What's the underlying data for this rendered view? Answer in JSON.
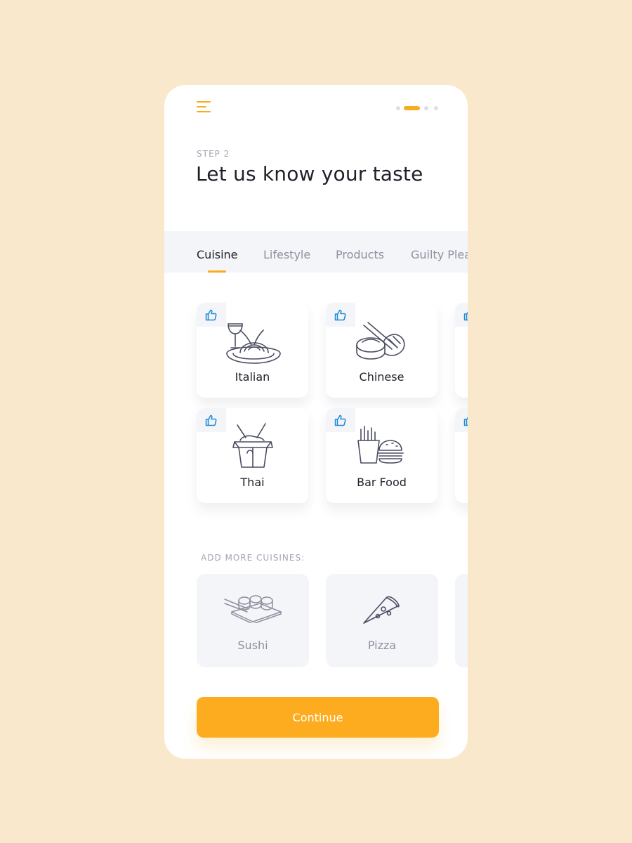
{
  "header": {
    "step_label": "STEP 2",
    "title": "Let us know your taste",
    "progress": {
      "total_steps": 4,
      "current_step": 2
    }
  },
  "tabs": [
    {
      "label": "Cuisine",
      "active": true
    },
    {
      "label": "Lifestyle",
      "active": false
    },
    {
      "label": "Products",
      "active": false
    },
    {
      "label": "Guilty Plea",
      "active": false
    }
  ],
  "cuisines": [
    {
      "label": "Italian",
      "icon": "pasta-icon",
      "liked": true
    },
    {
      "label": "Chinese",
      "icon": "dumpling-icon",
      "liked": true
    },
    {
      "label": "Thai",
      "icon": "noodle-box-icon",
      "liked": true
    },
    {
      "label": "Bar Food",
      "icon": "burger-fries-icon",
      "liked": true
    }
  ],
  "more_cuisines": {
    "label": "ADD MORE CUISINES:",
    "items": [
      {
        "label": "Sushi",
        "icon": "sushi-icon"
      },
      {
        "label": "Pizza",
        "icon": "pizza-icon"
      }
    ]
  },
  "continue_label": "Continue",
  "colors": {
    "accent": "#f6ad1f",
    "background": "#fae8cd",
    "like_icon": "#1a8ad8",
    "text_dark": "#1f2029",
    "text_muted": "#a3a6b3"
  }
}
